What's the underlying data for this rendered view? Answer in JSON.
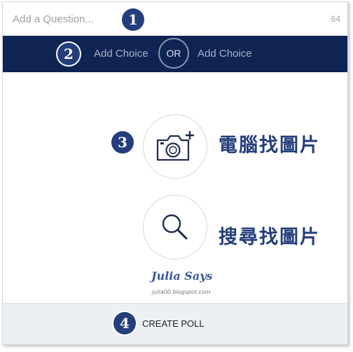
{
  "question": {
    "placeholder": "Add a Question...",
    "value": "",
    "char_count": "64"
  },
  "steps": [
    "1",
    "2",
    "3",
    "4"
  ],
  "choices": {
    "left_label": "Add Choice",
    "separator": "OR",
    "right_label": "Add Choice"
  },
  "media": {
    "upload_label": "電腦找圖片",
    "search_label": "搜尋找圖片",
    "upload_icon": "camera-plus-icon",
    "search_icon": "magnifier-icon"
  },
  "watermark": {
    "name": "Julia Says",
    "url": "julia00.blogspot.com"
  },
  "footer": {
    "create_label": "CREATE POLL"
  },
  "colors": {
    "accent": "#243e7b",
    "bar": "#0e2452",
    "footer_bg": "#eceff4"
  }
}
